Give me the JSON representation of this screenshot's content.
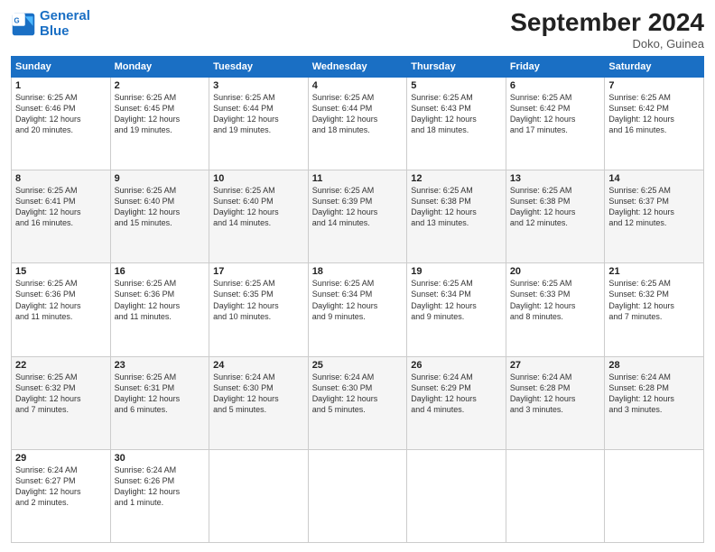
{
  "logo": {
    "line1": "General",
    "line2": "Blue"
  },
  "header": {
    "month": "September 2024",
    "location": "Doko, Guinea"
  },
  "days_of_week": [
    "Sunday",
    "Monday",
    "Tuesday",
    "Wednesday",
    "Thursday",
    "Friday",
    "Saturday"
  ],
  "weeks": [
    [
      {
        "day": "1",
        "sunrise": "6:25 AM",
        "sunset": "6:46 PM",
        "daylight": "12 hours and 20 minutes."
      },
      {
        "day": "2",
        "sunrise": "6:25 AM",
        "sunset": "6:45 PM",
        "daylight": "12 hours and 19 minutes."
      },
      {
        "day": "3",
        "sunrise": "6:25 AM",
        "sunset": "6:44 PM",
        "daylight": "12 hours and 19 minutes."
      },
      {
        "day": "4",
        "sunrise": "6:25 AM",
        "sunset": "6:44 PM",
        "daylight": "12 hours and 18 minutes."
      },
      {
        "day": "5",
        "sunrise": "6:25 AM",
        "sunset": "6:43 PM",
        "daylight": "12 hours and 18 minutes."
      },
      {
        "day": "6",
        "sunrise": "6:25 AM",
        "sunset": "6:42 PM",
        "daylight": "12 hours and 17 minutes."
      },
      {
        "day": "7",
        "sunrise": "6:25 AM",
        "sunset": "6:42 PM",
        "daylight": "12 hours and 16 minutes."
      }
    ],
    [
      {
        "day": "8",
        "sunrise": "6:25 AM",
        "sunset": "6:41 PM",
        "daylight": "12 hours and 16 minutes."
      },
      {
        "day": "9",
        "sunrise": "6:25 AM",
        "sunset": "6:40 PM",
        "daylight": "12 hours and 15 minutes."
      },
      {
        "day": "10",
        "sunrise": "6:25 AM",
        "sunset": "6:40 PM",
        "daylight": "12 hours and 14 minutes."
      },
      {
        "day": "11",
        "sunrise": "6:25 AM",
        "sunset": "6:39 PM",
        "daylight": "12 hours and 14 minutes."
      },
      {
        "day": "12",
        "sunrise": "6:25 AM",
        "sunset": "6:38 PM",
        "daylight": "12 hours and 13 minutes."
      },
      {
        "day": "13",
        "sunrise": "6:25 AM",
        "sunset": "6:38 PM",
        "daylight": "12 hours and 12 minutes."
      },
      {
        "day": "14",
        "sunrise": "6:25 AM",
        "sunset": "6:37 PM",
        "daylight": "12 hours and 12 minutes."
      }
    ],
    [
      {
        "day": "15",
        "sunrise": "6:25 AM",
        "sunset": "6:36 PM",
        "daylight": "12 hours and 11 minutes."
      },
      {
        "day": "16",
        "sunrise": "6:25 AM",
        "sunset": "6:36 PM",
        "daylight": "12 hours and 11 minutes."
      },
      {
        "day": "17",
        "sunrise": "6:25 AM",
        "sunset": "6:35 PM",
        "daylight": "12 hours and 10 minutes."
      },
      {
        "day": "18",
        "sunrise": "6:25 AM",
        "sunset": "6:34 PM",
        "daylight": "12 hours and 9 minutes."
      },
      {
        "day": "19",
        "sunrise": "6:25 AM",
        "sunset": "6:34 PM",
        "daylight": "12 hours and 9 minutes."
      },
      {
        "day": "20",
        "sunrise": "6:25 AM",
        "sunset": "6:33 PM",
        "daylight": "12 hours and 8 minutes."
      },
      {
        "day": "21",
        "sunrise": "6:25 AM",
        "sunset": "6:32 PM",
        "daylight": "12 hours and 7 minutes."
      }
    ],
    [
      {
        "day": "22",
        "sunrise": "6:25 AM",
        "sunset": "6:32 PM",
        "daylight": "12 hours and 7 minutes."
      },
      {
        "day": "23",
        "sunrise": "6:25 AM",
        "sunset": "6:31 PM",
        "daylight": "12 hours and 6 minutes."
      },
      {
        "day": "24",
        "sunrise": "6:24 AM",
        "sunset": "6:30 PM",
        "daylight": "12 hours and 5 minutes."
      },
      {
        "day": "25",
        "sunrise": "6:24 AM",
        "sunset": "6:30 PM",
        "daylight": "12 hours and 5 minutes."
      },
      {
        "day": "26",
        "sunrise": "6:24 AM",
        "sunset": "6:29 PM",
        "daylight": "12 hours and 4 minutes."
      },
      {
        "day": "27",
        "sunrise": "6:24 AM",
        "sunset": "6:28 PM",
        "daylight": "12 hours and 3 minutes."
      },
      {
        "day": "28",
        "sunrise": "6:24 AM",
        "sunset": "6:28 PM",
        "daylight": "12 hours and 3 minutes."
      }
    ],
    [
      {
        "day": "29",
        "sunrise": "6:24 AM",
        "sunset": "6:27 PM",
        "daylight": "12 hours and 2 minutes."
      },
      {
        "day": "30",
        "sunrise": "6:24 AM",
        "sunset": "6:26 PM",
        "daylight": "12 hours and 1 minute."
      },
      null,
      null,
      null,
      null,
      null
    ]
  ]
}
